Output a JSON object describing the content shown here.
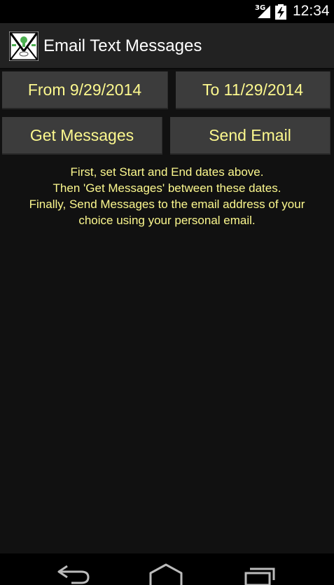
{
  "status_bar": {
    "network": "3G",
    "time": "12:34",
    "signal_icon": "signal-bars-icon",
    "battery_icon": "battery-charging-icon"
  },
  "action_bar": {
    "app_icon": "envelope-app-icon",
    "title": "Email Text Messages"
  },
  "buttons": {
    "from_label": "From 9/29/2014",
    "to_label": "To 11/29/2014",
    "get_label": "Get Messages",
    "send_label": "Send Email"
  },
  "instructions": {
    "line1": "First, set Start and End dates above.",
    "line2": "Then 'Get Messages' between these dates.",
    "line3": "Finally, Send Messages to the email address of your",
    "line4": "choice using your personal email."
  },
  "nav_bar": {
    "back_icon": "back-icon",
    "home_icon": "home-icon",
    "recents_icon": "recent-apps-icon"
  },
  "colors": {
    "accent_text": "#fcf88e",
    "button_bg": "#3c3c3c",
    "screen_bg": "#111111",
    "action_bar_bg": "#222222"
  }
}
